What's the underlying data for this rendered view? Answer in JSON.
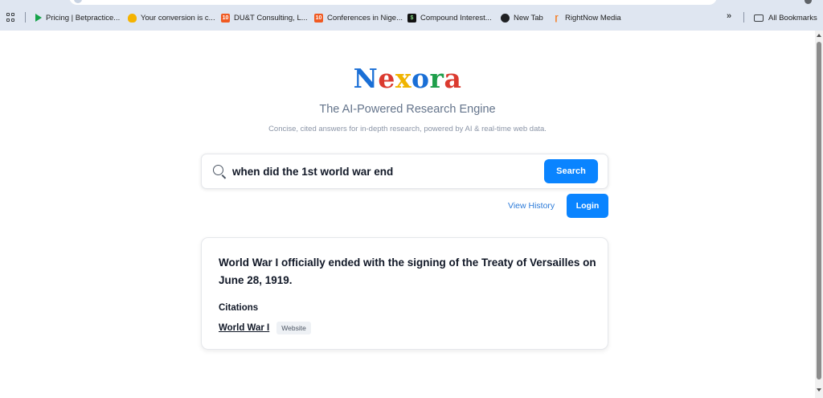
{
  "browser": {
    "bookmarks": [
      {
        "label": "Pricing | Betpractice...",
        "icon": "betpractice-favicon"
      },
      {
        "label": "Your conversion is c...",
        "icon": "hand-favicon"
      },
      {
        "label": "DU&T Consulting, L...",
        "icon": "orange-10-favicon",
        "glyph": "10"
      },
      {
        "label": "Conferences in Nige...",
        "icon": "orange-10-favicon",
        "glyph": "10"
      },
      {
        "label": "Compound Interest...",
        "icon": "dollar-favicon",
        "glyph": "$"
      },
      {
        "label": "New Tab",
        "icon": "globe-favicon"
      },
      {
        "label": "RightNow Media",
        "icon": "rightnow-favicon",
        "glyph": "ɼ"
      }
    ],
    "overflow": "»",
    "all_bookmarks": "All Bookmarks"
  },
  "page": {
    "logo_letters": [
      {
        "char": "N",
        "color": "#1a6fd6"
      },
      {
        "char": "e",
        "color": "#db3a2f"
      },
      {
        "char": "x",
        "color": "#f0b400"
      },
      {
        "char": "o",
        "color": "#1a6fd6"
      },
      {
        "char": "r",
        "color": "#1e9e4a"
      },
      {
        "char": "a",
        "color": "#db3a2f"
      }
    ],
    "tagline": "The AI-Powered Research Engine",
    "subtagline": "Concise, cited answers for in-depth research, powered by AI & real-time web data.",
    "search": {
      "value": "when did the 1st world war end",
      "button": "Search"
    },
    "view_history": "View History",
    "login": "Login",
    "answer": {
      "text": "World War I officially ended with the signing of the Treaty of Versailles on June 28, 1919.",
      "citations_title": "Citations",
      "citations": [
        {
          "title": "World War I",
          "type": "Website"
        }
      ]
    }
  },
  "colors": {
    "accent": "#0a84ff",
    "link": "#2b7ad8"
  }
}
